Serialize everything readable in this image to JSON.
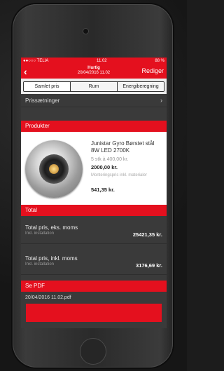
{
  "status": {
    "carrier": "●●○○○ TELIA",
    "time": "11.02",
    "battery": "88 %"
  },
  "nav": {
    "back": "‹",
    "title": "Hurtig",
    "subtitle": "20/04/2016 11.02",
    "edit": "Rediger"
  },
  "tabs": [
    "Samlet pris",
    "Rum",
    "Energiberegning"
  ],
  "prissaetninger": "Prissætninger",
  "sections": {
    "products": "Produkter",
    "total": "Total",
    "pdf": "Se PDF"
  },
  "product": {
    "name": "Junistar Gyro Børstet stål 8W LED 2700K",
    "qty": "5 stk à 400,00 kr.",
    "subtotal": "2000,00 kr.",
    "mount_label": "Monteringspris inkl. materialer",
    "mount_value": "541,35 kr."
  },
  "totals": [
    {
      "label": "Total pris, eks. moms",
      "sub": "Inkl. installation",
      "value": "25421,35 kr."
    },
    {
      "label": "Total pris, inkl. moms",
      "sub": "Inkl. installation",
      "value": "3176,69 kr."
    }
  ],
  "pdf_file": "20/04/2016 11.02.pdf",
  "colors": {
    "accent": "#e4101e"
  }
}
